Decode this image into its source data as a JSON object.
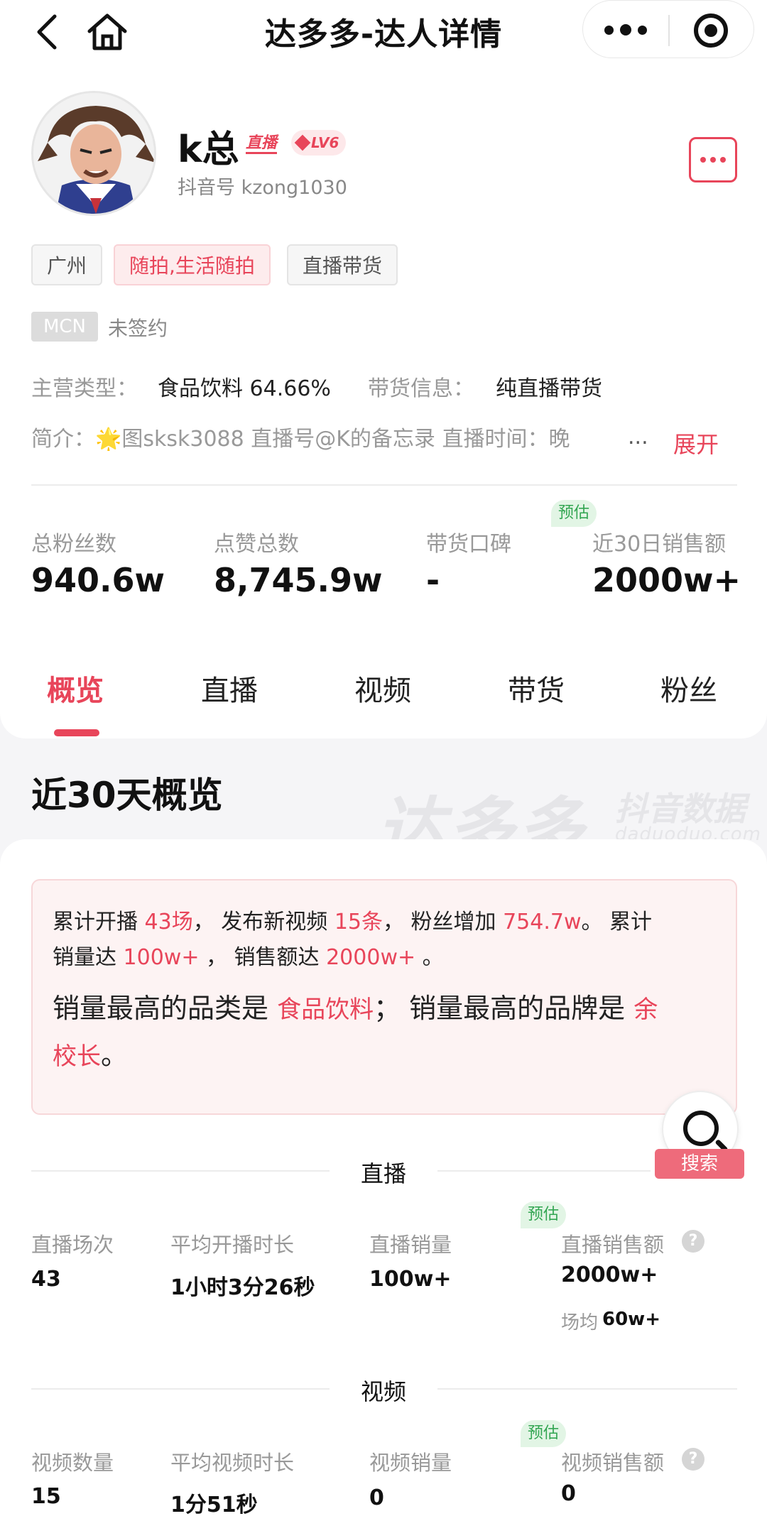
{
  "nav": {
    "title": "达多多-达人详情"
  },
  "profile": {
    "name": "k总",
    "live_tag": "直播",
    "level": "LV6",
    "douyin_id": "抖音号 kzong1030"
  },
  "tags": [
    "广州",
    "随拍,生活随拍",
    "直播带货"
  ],
  "mcn": {
    "badge": "MCN",
    "status": "未签约"
  },
  "info": {
    "category_label": "主营类型：",
    "category_value": "食品饮料 64.66%",
    "goods_label": "带货信息：",
    "goods_value": "纯直播带货",
    "intro_label": "简介：",
    "intro_star": "🌟",
    "intro_text": "图sksk3088 直播号@K的备忘录 直播时间：晚",
    "intro_ellipsis": "...",
    "expand": "展开"
  },
  "stats": [
    {
      "label": "总粉丝数",
      "value": "940.6w"
    },
    {
      "label": "点赞总数",
      "value": "8,745.9w"
    },
    {
      "label": "带货口碑",
      "value": "-"
    },
    {
      "label": "近30日销售额",
      "value": "2000w+",
      "badge": "预估"
    }
  ],
  "tabs": [
    "概览",
    "直播",
    "视频",
    "带货",
    "粉丝"
  ],
  "overview": {
    "title": "近30天概览",
    "watermark": "达多多",
    "watermark_sub": "抖音数据",
    "watermark_url": "daduoduo.com"
  },
  "summary": {
    "t1": "累计开播 ",
    "v1": "43场",
    "t2": "， 发布新视频 ",
    "v2": "15条",
    "t3": "， 粉丝增加 ",
    "v3": "754.7w",
    "t4": "。 累计",
    "t5": "销量达 ",
    "v5": "100w+",
    "t6": " ， 销售额达 ",
    "v6": "2000w+",
    "t7": " 。",
    "b1": "销量最高的品类是 ",
    "bv1": "食品饮料",
    "b2": "； 销量最高的品牌是 ",
    "bv2a": "余",
    "bv2b": "校长",
    "b3": "。"
  },
  "search": {
    "label": "搜索"
  },
  "live_section": {
    "title": "直播",
    "badge": "预估",
    "metrics": [
      {
        "label": "直播场次",
        "value": "43"
      },
      {
        "label": "平均开播时长",
        "value": "1小时3分26秒"
      },
      {
        "label": "直播销量",
        "value": "100w+"
      },
      {
        "label": "直播销售额",
        "value": "2000w+"
      }
    ],
    "sub_label": "场均",
    "sub_value": "60w+"
  },
  "video_section": {
    "title": "视频",
    "badge": "预估",
    "metrics": [
      {
        "label": "视频数量",
        "value": "15"
      },
      {
        "label": "平均视频时长",
        "value": "1分51秒"
      },
      {
        "label": "视频销量",
        "value": "0"
      },
      {
        "label": "视频销售额",
        "value": "0"
      }
    ]
  },
  "colors": {
    "accent": "#e8455a",
    "estimate_green": "#33a652"
  },
  "icons": [
    "back-arrow-icon",
    "home-icon",
    "more-dots-icon",
    "target-icon",
    "menu-dots-icon",
    "search-icon",
    "help-icon",
    "diamond-icon"
  ]
}
